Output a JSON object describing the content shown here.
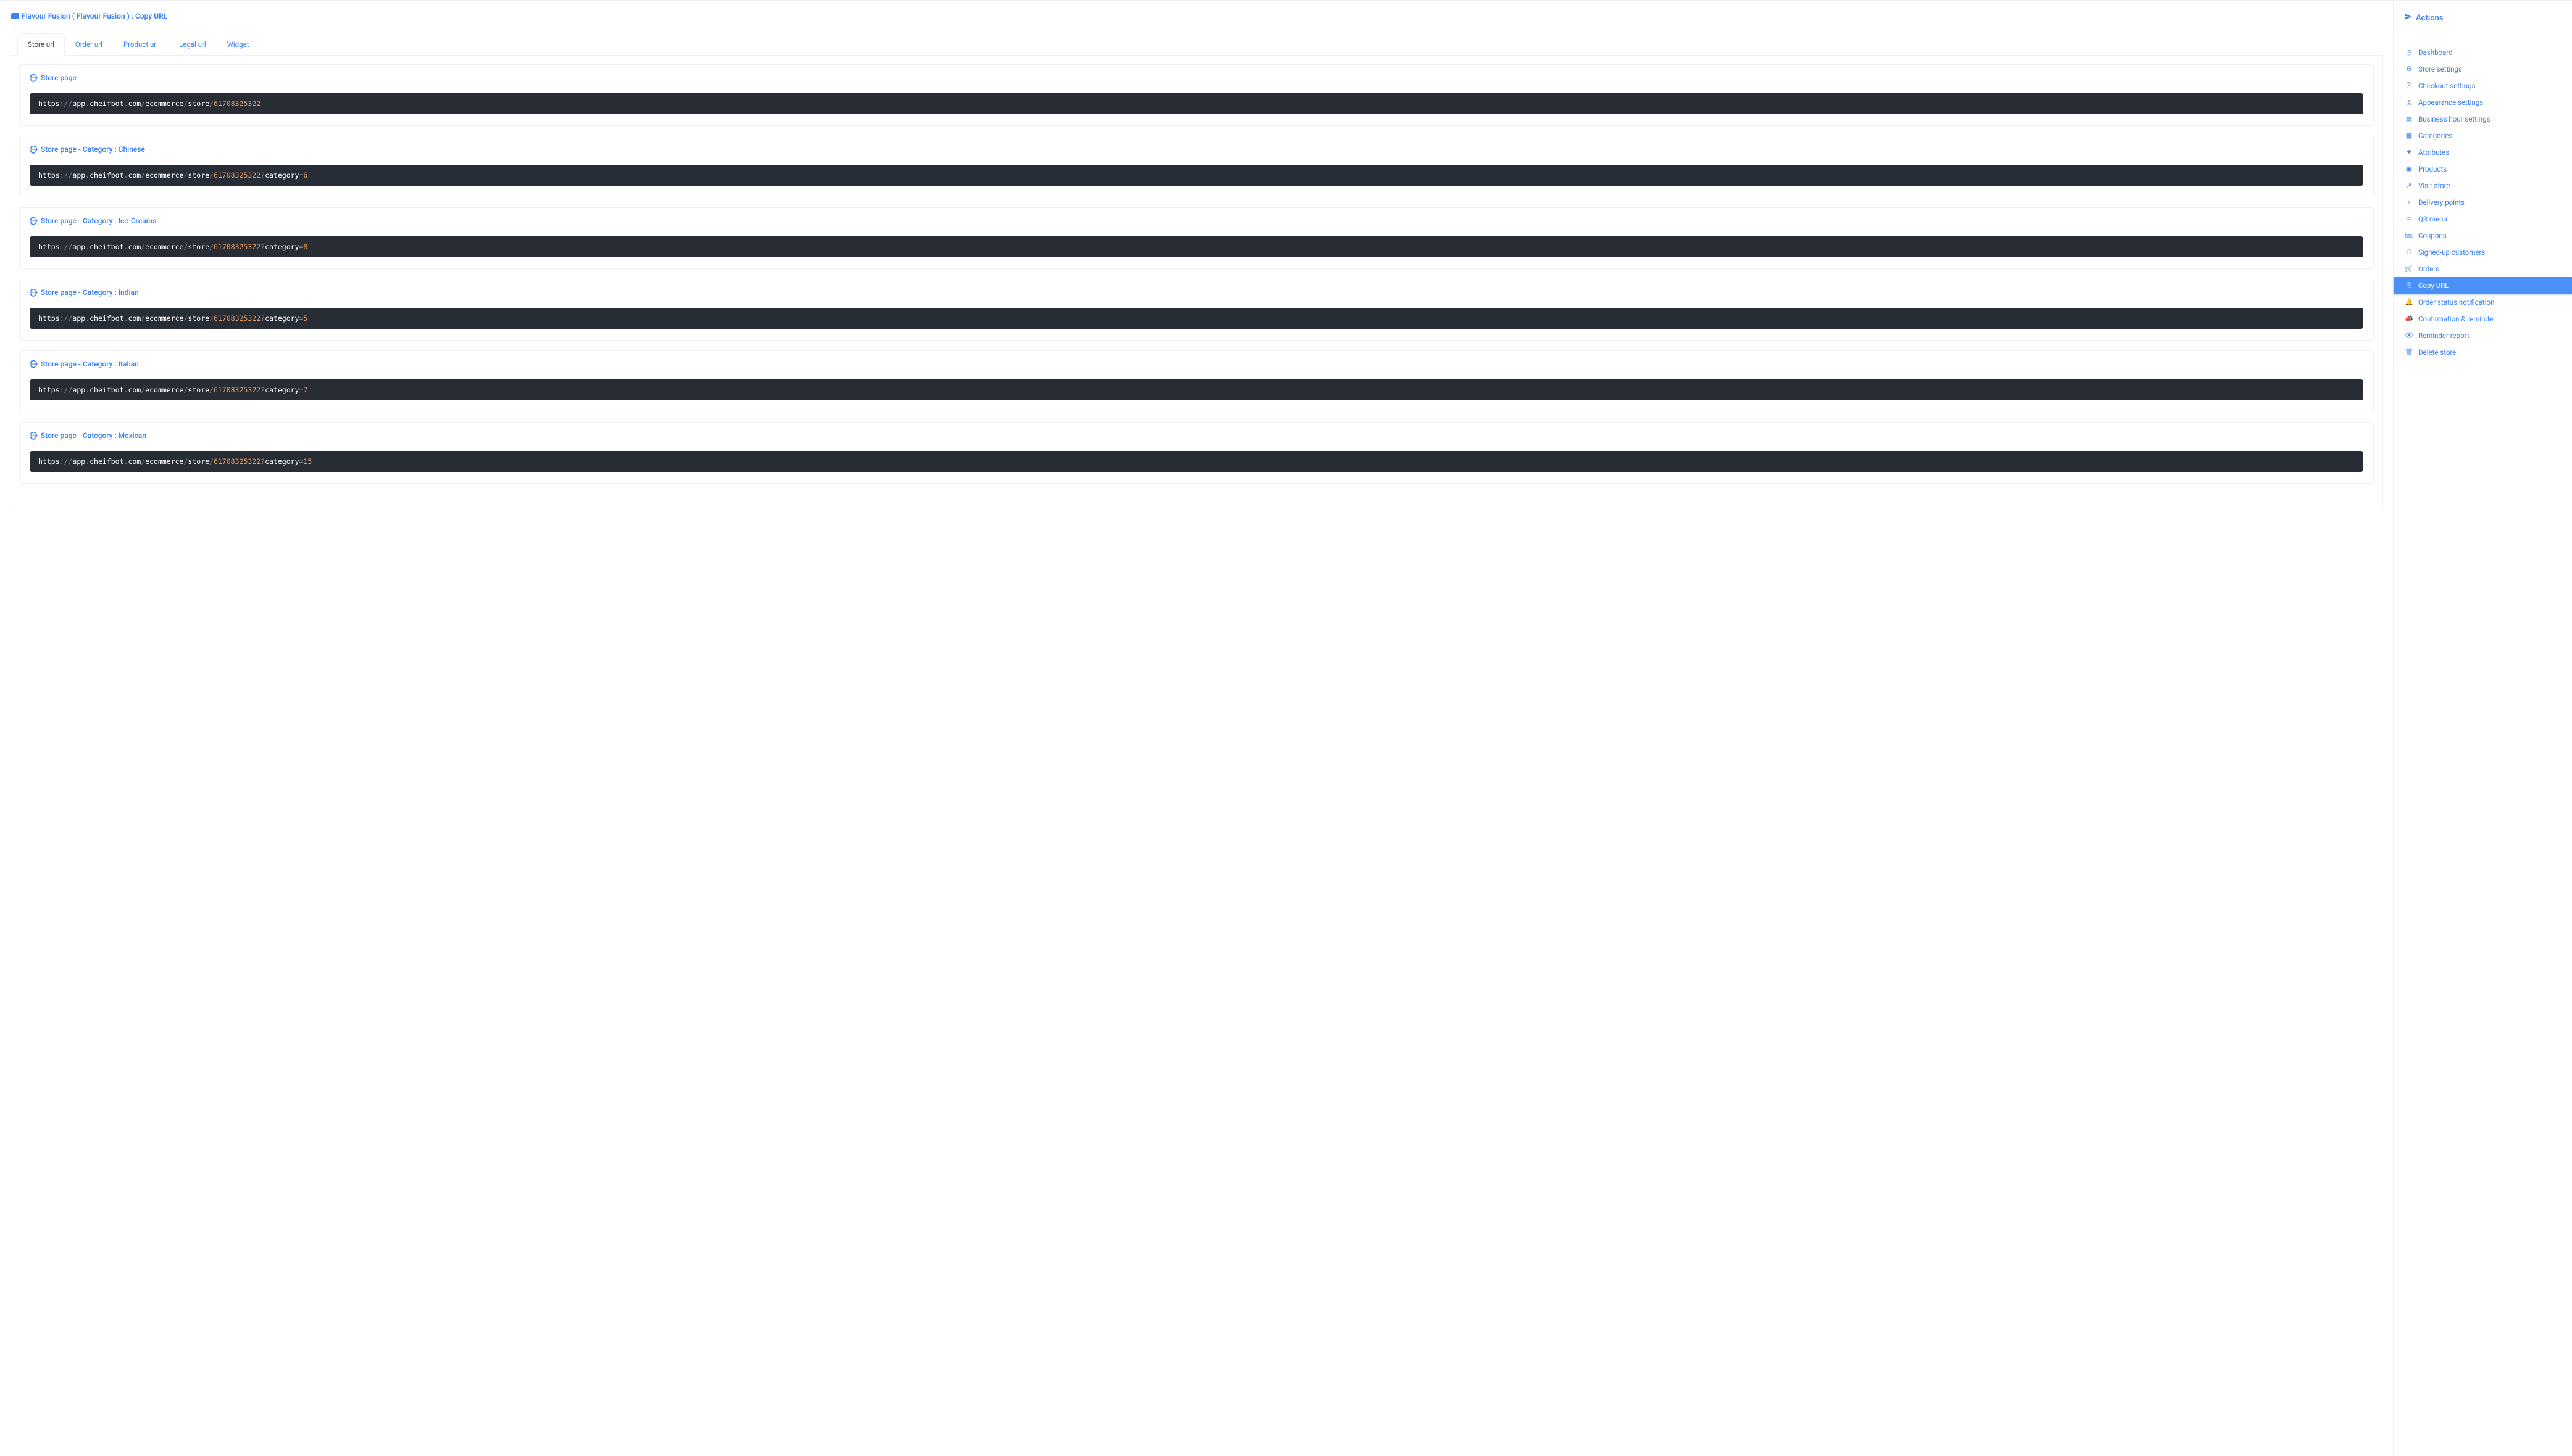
{
  "breadcrumb": {
    "store1": "Flavour Fusion",
    "paren_open": "(",
    "store2": "Flavour Fusion",
    "paren_colon": ") :",
    "page": "Copy URL"
  },
  "tabs": [
    {
      "label": "Store url",
      "active": true
    },
    {
      "label": "Order url",
      "active": false
    },
    {
      "label": "Product url",
      "active": false
    },
    {
      "label": "Legal url",
      "active": false
    },
    {
      "label": "Widget",
      "active": false
    }
  ],
  "url_parts": {
    "scheme": "https",
    "sep": "://",
    "host1": "app",
    "dot": ".",
    "host2": "cheifbot",
    "host3": "com",
    "slash": "/",
    "seg1": "ecommerce",
    "seg2": "store",
    "store_id": "61708325322",
    "q": "?",
    "param_name": "category",
    "eq": "="
  },
  "cards": [
    {
      "title": "Store page",
      "param_value": null
    },
    {
      "title": "Store page - Category : Chinese",
      "param_value": "6"
    },
    {
      "title": "Store page - Category : Ice-Creams",
      "param_value": "8"
    },
    {
      "title": "Store page - Category : Indian",
      "param_value": "5"
    },
    {
      "title": "Store page - Category : Italian",
      "param_value": "7"
    },
    {
      "title": "Store page - Category : Mexican",
      "param_value": "15"
    }
  ],
  "side": {
    "title": "Actions",
    "items": [
      {
        "icon": "dash",
        "label": "Dashboard"
      },
      {
        "icon": "gear",
        "label": "Store settings"
      },
      {
        "icon": "checkout",
        "label": "Checkout settings"
      },
      {
        "icon": "palette",
        "label": "Appearance settings"
      },
      {
        "icon": "calendar",
        "label": "Business hour settings"
      },
      {
        "icon": "grid",
        "label": "Categories"
      },
      {
        "icon": "star",
        "label": "Attributes"
      },
      {
        "icon": "box",
        "label": "Products"
      },
      {
        "icon": "external",
        "label": "Visit store"
      },
      {
        "icon": "pin",
        "label": "Delivery points"
      },
      {
        "icon": "qr",
        "label": "QR menu"
      },
      {
        "icon": "ticket",
        "label": "Coupons"
      },
      {
        "icon": "users",
        "label": "Signed-up customers"
      },
      {
        "icon": "cart",
        "label": "Orders"
      },
      {
        "icon": "copy",
        "label": "Copy URL",
        "active": true
      },
      {
        "icon": "bell",
        "label": "Order status notification"
      },
      {
        "icon": "megaphone",
        "label": "Confirmation & reminder"
      },
      {
        "icon": "eye",
        "label": "Reminder report"
      },
      {
        "icon": "trash",
        "label": "Delete store"
      }
    ]
  },
  "icons": {
    "dash": "◷",
    "gear": "⚙",
    "checkout": "⎘",
    "palette": "◎",
    "calendar": "▤",
    "grid": "▦",
    "star": "★",
    "box": "▣",
    "external": "↗",
    "pin": "⌖",
    "qr": "⌗",
    "ticket": "🎟",
    "users": "⚇",
    "cart": "🛒",
    "copy": "⎘",
    "bell": "🔔",
    "megaphone": "📣",
    "eye": "👁",
    "trash": "🗑"
  }
}
